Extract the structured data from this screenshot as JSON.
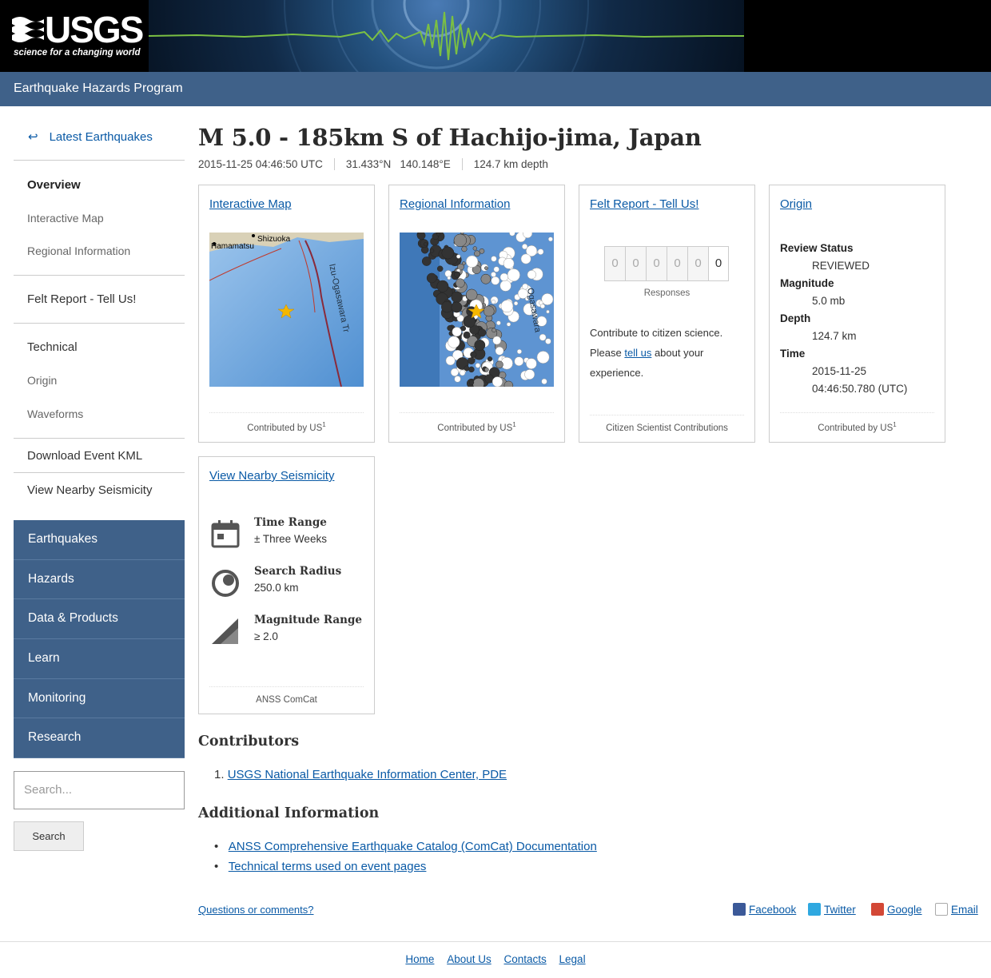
{
  "header": {
    "logo_text": "USGS",
    "logo_tagline": "science for a changing world",
    "program": "Earthquake Hazards Program"
  },
  "event": {
    "title": "M 5.0 - 185km S of Hachijo-jima, Japan",
    "time": "2015-11-25 04:46:50 UTC",
    "coordinates": "31.433°N   140.148°E",
    "depth": "124.7 km depth"
  },
  "sidebar": {
    "back_label": "Latest Earthquakes",
    "overview": "Overview",
    "interactive_map": "Interactive Map",
    "regional_information": "Regional Information",
    "felt_report": "Felt Report - Tell Us!",
    "technical": "Technical",
    "origin": "Origin",
    "waveforms": "Waveforms",
    "download_kml": "Download Event KML",
    "view_nearby": "View Nearby Seismicity"
  },
  "site_nav": [
    "Earthquakes",
    "Hazards",
    "Data & Products",
    "Learn",
    "Monitoring",
    "Research"
  ],
  "search": {
    "placeholder": "Search...",
    "button": "Search"
  },
  "cards": {
    "interactive_map": {
      "title": "Interactive Map",
      "footer": "Contributed by US",
      "sup": "1",
      "labels": {
        "city1": "Shizuoka",
        "city2": "Hamamatsu",
        "trench": "Izu-Ogasawara Tr"
      }
    },
    "regional": {
      "title": "Regional Information",
      "footer": "Contributed by US",
      "sup": "1",
      "trench": "Ogasawara"
    },
    "felt": {
      "title": "Felt Report - Tell Us!",
      "digits": [
        "0",
        "0",
        "0",
        "0",
        "0",
        "0"
      ],
      "responses_label": "Responses",
      "text_before": "Contribute to citizen science. Please ",
      "link": "tell us",
      "text_after": " about your experience.",
      "footer": "Citizen Scientist Contributions"
    },
    "origin": {
      "title": "Origin",
      "review_status_label": "Review Status",
      "review_status": "REVIEWED",
      "magnitude_label": "Magnitude",
      "magnitude": "5.0 mb",
      "depth_label": "Depth",
      "depth": "124.7 km",
      "time_label": "Time",
      "time_date": "2015-11-25",
      "time_clock": "04:46:50.780 (UTC)",
      "footer": "Contributed by US",
      "sup": "1"
    },
    "nearby": {
      "title": "View Nearby Seismicity",
      "time_range_label": "Time Range",
      "time_range": "± Three Weeks",
      "search_radius_label": "Search Radius",
      "search_radius": "250.0 km",
      "magnitude_range_label": "Magnitude Range",
      "magnitude_range": "≥ 2.0",
      "footer": "ANSS ComCat"
    }
  },
  "contributors": {
    "heading": "Contributors",
    "items": [
      "USGS National Earthquake Information Center, PDE"
    ]
  },
  "additional": {
    "heading": "Additional Information",
    "items": [
      "ANSS Comprehensive Earthquake Catalog (ComCat) Documentation",
      "Technical terms used on event pages"
    ]
  },
  "questions": "Questions or comments?",
  "social": {
    "facebook": "Facebook",
    "twitter": "Twitter",
    "google": "Google",
    "email": "Email"
  },
  "footer": [
    "Home",
    "About Us",
    "Contacts",
    "Legal"
  ],
  "colors": {
    "nav_blue": "#3f6189",
    "link_blue": "#0a5aa6"
  }
}
